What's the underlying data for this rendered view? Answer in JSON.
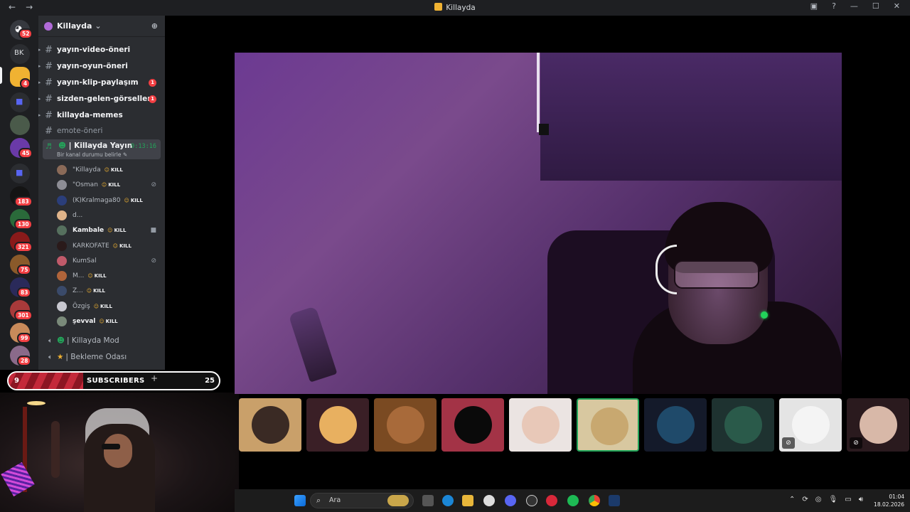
{
  "window": {
    "title": "Killayda",
    "nav_back": "←",
    "nav_forward": "→",
    "help": "?",
    "minimize": "—",
    "maximize": "☐",
    "close": "✕"
  },
  "server_rail": {
    "home_badge": "52",
    "bk_label": "BK",
    "badges": [
      "4",
      "45",
      "183",
      "130",
      "321",
      "75",
      "83",
      "301",
      "99",
      "28"
    ]
  },
  "guild": {
    "name": "Killayda",
    "chevron": "⌄",
    "add_member_icon": "person-add-icon"
  },
  "channels": [
    {
      "name": "yayın-video-öneri",
      "unread": true,
      "count": ""
    },
    {
      "name": "yayın-oyun-öneri",
      "unread": true,
      "count": ""
    },
    {
      "name": "yayın-klip-paylaşım",
      "unread": true,
      "count": "1"
    },
    {
      "name": "sizden-gelen-görseller",
      "unread": true,
      "count": "1"
    },
    {
      "name": "killayda-memes",
      "unread": true,
      "count": ""
    },
    {
      "name": "emote-öneri",
      "unread": false,
      "count": ""
    }
  ],
  "voice_channel": {
    "name": "| Killayda Yayın",
    "status": "Bir kanal durumu belirle",
    "timer": "9:13:16"
  },
  "voice_members": [
    {
      "name": "\"Killayda",
      "tag": "KILL",
      "color": "#8a6a58",
      "icon": "",
      "bold": false
    },
    {
      "name": "\"Osman",
      "tag": "KILL",
      "color": "#8d8d95",
      "icon": "mic-muted-icon",
      "bold": false
    },
    {
      "name": "(K)Kralmaga80",
      "tag": "KILL",
      "color": "#2b3e7a",
      "icon": "",
      "bold": false
    },
    {
      "name": "d...",
      "tag": "",
      "color": "#e0b48a",
      "icon": "",
      "bold": false
    },
    {
      "name": "Kambale",
      "tag": "KILL",
      "color": "#56705e",
      "icon": "video-icon",
      "bold": true
    },
    {
      "name": "KARKOFATE",
      "tag": "KILL",
      "color": "#2a1a1a",
      "icon": "",
      "bold": false
    },
    {
      "name": "KumSal",
      "tag": "",
      "color": "#c05a6a",
      "icon": "mic-muted-icon",
      "bold": false
    },
    {
      "name": "M...",
      "tag": "KILL",
      "color": "#b0643a",
      "icon": "",
      "bold": false
    },
    {
      "name": "Z...",
      "tag": "KILL",
      "color": "#3a4a6a",
      "icon": "",
      "bold": false
    },
    {
      "name": "Özgiş",
      "tag": "KILL",
      "color": "#c8c8d0",
      "icon": "",
      "bold": false
    },
    {
      "name": "şevval",
      "tag": "KILL",
      "color": "#7a8a7a",
      "icon": "",
      "bold": true
    }
  ],
  "other_voice": [
    {
      "name": "| Killayda Mod"
    },
    {
      "name": "| Bekleme Odası"
    }
  ],
  "subscribers": {
    "current": "9",
    "label": "SUBSCRIBERS",
    "plus": "+",
    "goal": "25"
  },
  "tiles": [
    {
      "color_bg": "#c9a06a",
      "color_av": "#3a2a24",
      "muted": false,
      "speaking": false
    },
    {
      "color_bg": "#3a1f26",
      "color_av": "#e8b060",
      "muted": false,
      "speaking": false
    },
    {
      "color_bg": "#7a4a22",
      "color_av": "#a86a3a",
      "muted": false,
      "speaking": false
    },
    {
      "color_bg": "#a33346",
      "color_av": "#0a0a0a",
      "muted": false,
      "speaking": false
    },
    {
      "color_bg": "#ebe4e2",
      "color_av": "#e8c8b8",
      "muted": false,
      "speaking": false
    },
    {
      "color_bg": "#d8c8a0",
      "color_av": "#c8a870",
      "muted": false,
      "speaking": true
    },
    {
      "color_bg": "#141a2a",
      "color_av": "#1f4a6a",
      "muted": false,
      "speaking": false
    },
    {
      "color_bg": "#1e3230",
      "color_av": "#2a5a4a",
      "muted": false,
      "speaking": false
    },
    {
      "color_bg": "#e4e4e4",
      "color_av": "#f4f4f4",
      "muted": true,
      "speaking": false
    },
    {
      "color_bg": "#2a1a1e",
      "color_av": "#d8b8a8",
      "muted": true,
      "speaking": false
    }
  ],
  "taskbar": {
    "search_placeholder": "Ara",
    "search_icon": "search-icon",
    "time": "01:04",
    "date": "18.02.2026",
    "tray_expand": "⌃"
  },
  "colors": {
    "accent_green": "#23a55a",
    "notification_red": "#f23f43",
    "sidebar_bg": "#2b2d31",
    "rail_bg": "#1e1f22"
  }
}
